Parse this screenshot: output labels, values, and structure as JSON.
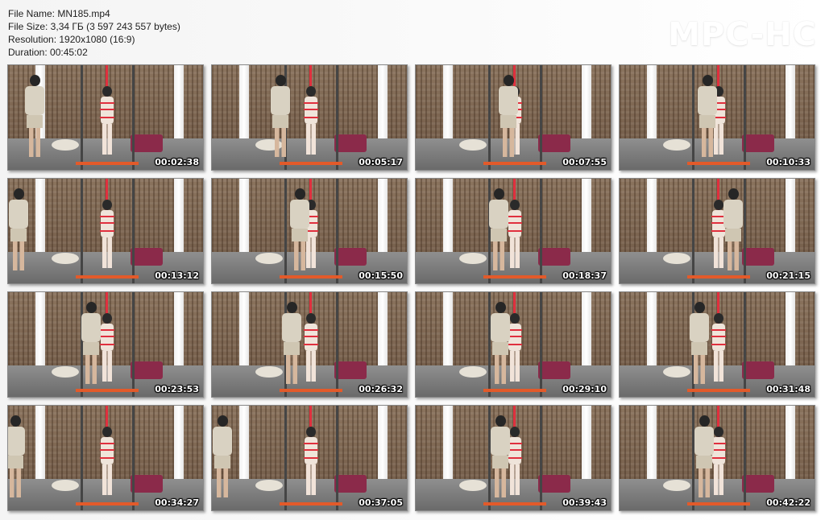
{
  "info": {
    "file_name": "File Name: MN185.mp4",
    "file_size": "File Size: 3,34 ГБ (3 597 243 557 bytes)",
    "resolution": "Resolution: 1920x1080 (16:9)",
    "duration": "Duration: 00:45:02"
  },
  "logo": "MPC-HC",
  "thumbnails": [
    {
      "time": "00:02:38"
    },
    {
      "time": "00:05:17"
    },
    {
      "time": "00:07:55"
    },
    {
      "time": "00:10:33"
    },
    {
      "time": "00:13:12"
    },
    {
      "time": "00:15:50"
    },
    {
      "time": "00:18:37"
    },
    {
      "time": "00:21:15"
    },
    {
      "time": "00:23:53"
    },
    {
      "time": "00:26:32"
    },
    {
      "time": "00:29:10"
    },
    {
      "time": "00:31:48"
    },
    {
      "time": "00:34:27"
    },
    {
      "time": "00:37:05"
    },
    {
      "time": "00:39:43"
    },
    {
      "time": "00:42:22"
    }
  ]
}
